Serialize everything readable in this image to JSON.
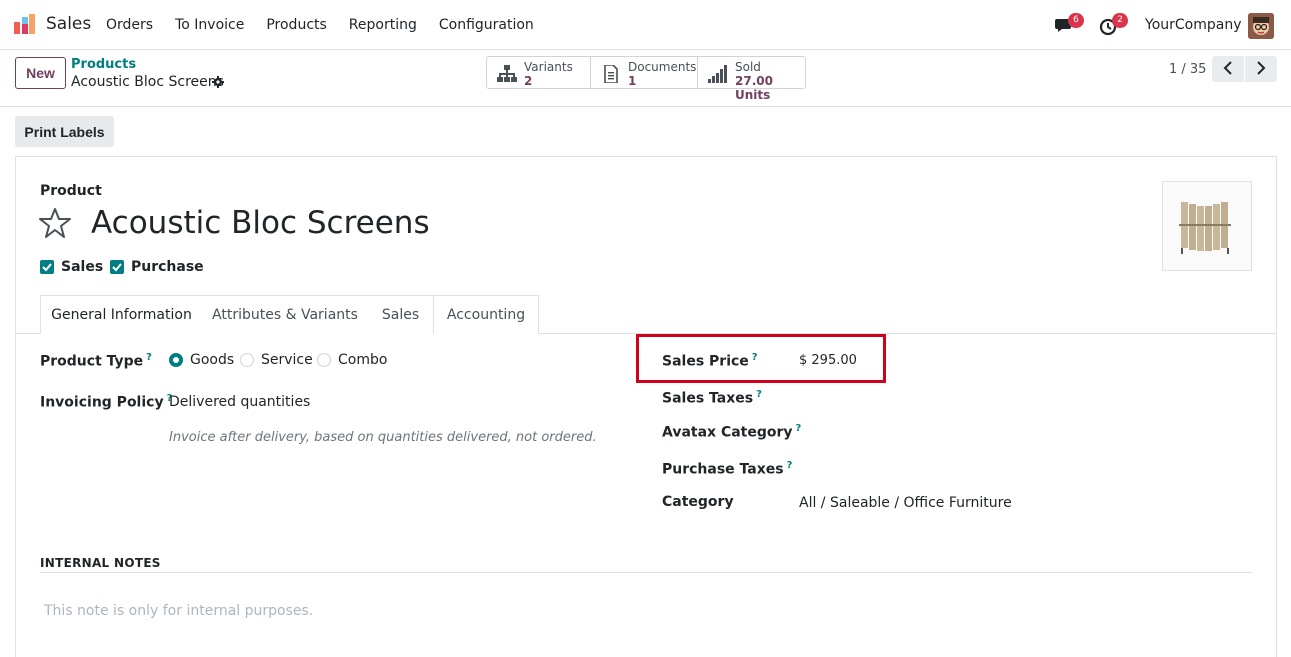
{
  "nav": {
    "app_name": "Sales",
    "menu": [
      "Orders",
      "To Invoice",
      "Products",
      "Reporting",
      "Configuration"
    ],
    "chat_count": "6",
    "activity_count": "2",
    "company": "YourCompany"
  },
  "control": {
    "new_label": "New",
    "breadcrumb_parent": "Products",
    "breadcrumb_current": "Acoustic Bloc Screens",
    "stats": {
      "variants": {
        "label": "Variants",
        "value": "2"
      },
      "documents": {
        "label": "Documents",
        "value": "1"
      },
      "sold": {
        "label": "Sold",
        "value": "27.00 Units"
      }
    },
    "pager": "1 / 35"
  },
  "actions": {
    "print_labels": "Print Labels"
  },
  "form": {
    "product_label": "Product",
    "title": "Acoustic Bloc Screens",
    "sales_checkbox": "Sales",
    "purchase_checkbox": "Purchase",
    "tabs": [
      "General Information",
      "Attributes & Variants",
      "Sales",
      "Accounting"
    ],
    "product_type_label": "Product Type",
    "product_type_options": [
      "Goods",
      "Service",
      "Combo"
    ],
    "invoicing_policy_label": "Invoicing Policy",
    "invoicing_policy_value": "Delivered quantities",
    "invoicing_policy_note": "Invoice after delivery, based on quantities delivered, not ordered.",
    "sales_price_label": "Sales Price",
    "sales_price_value": "$ 295.00",
    "sales_taxes_label": "Sales Taxes",
    "avatax_category_label": "Avatax Category",
    "purchase_taxes_label": "Purchase Taxes",
    "category_label": "Category",
    "category_value": "All / Saleable / Office Furniture",
    "help_mark": "?",
    "internal_notes_heading": "INTERNAL NOTES",
    "internal_notes_placeholder": "This note is only for internal purposes."
  },
  "colors": {
    "accent": "#017e84",
    "brand": "#71405f",
    "highlight": "#d0021b"
  }
}
